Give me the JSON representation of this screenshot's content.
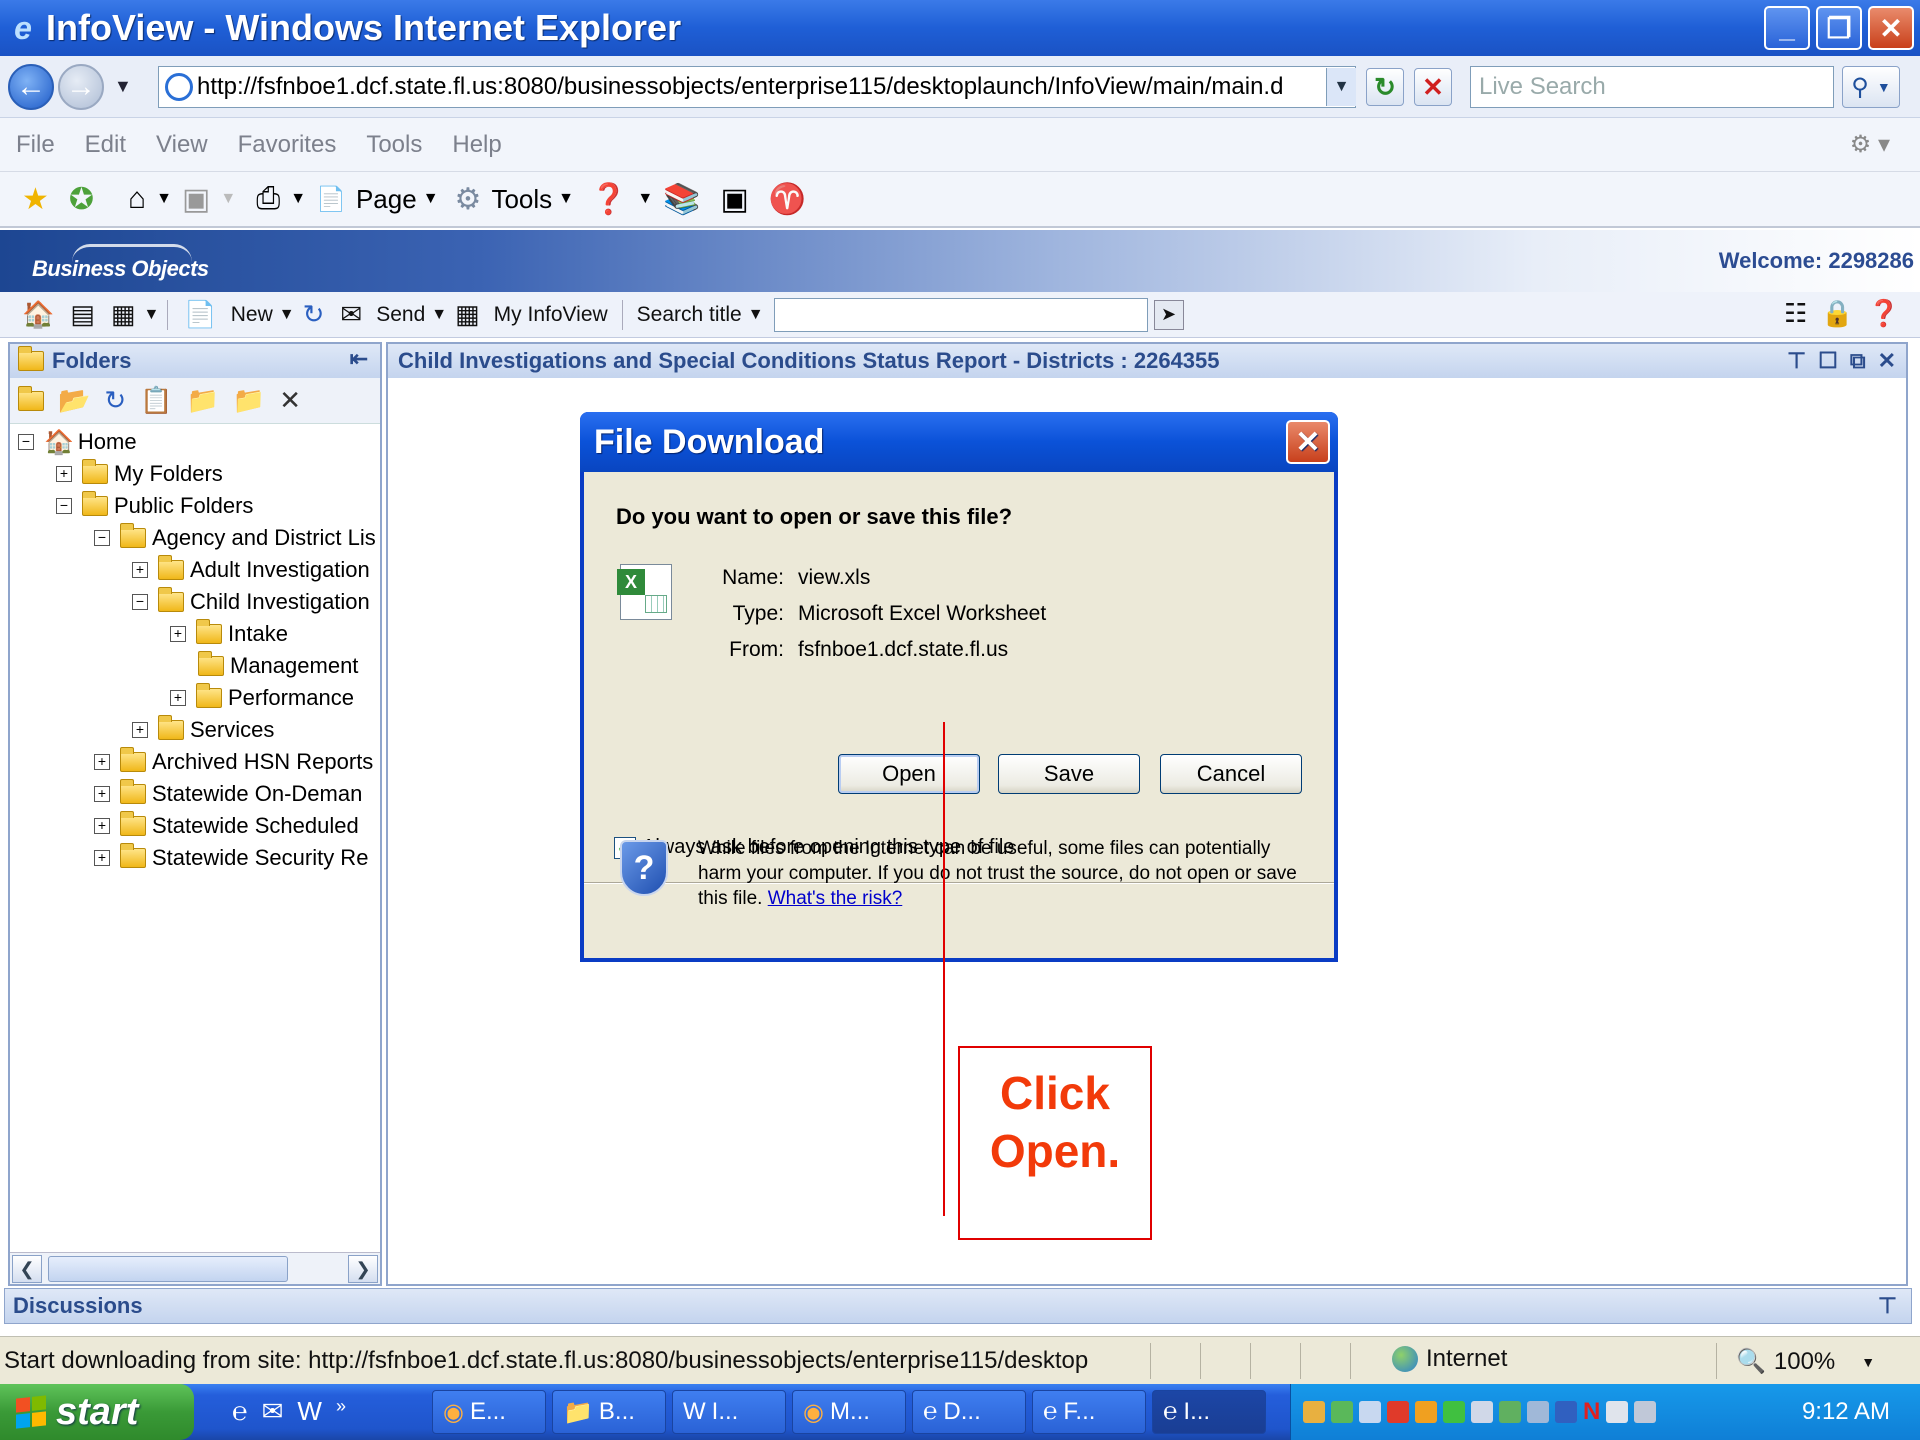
{
  "window": {
    "title": "InfoView - Windows Internet Explorer",
    "minimize": "_",
    "maximize": "❐",
    "close": "✕"
  },
  "address": {
    "url": "http://fsfnboe1.dcf.state.fl.us:8080/businessobjects/enterprise115/desktoplaunch/InfoView/main/main.d",
    "search_placeholder": "Live Search"
  },
  "menu": {
    "items": [
      "File",
      "Edit",
      "View",
      "Favorites",
      "Tools",
      "Help"
    ]
  },
  "commandbar": {
    "page_label": "Page",
    "tools_label": "Tools"
  },
  "infoview": {
    "logo": "Business Objects",
    "welcome": "Welcome: 2298286",
    "toolbar": {
      "new_label": "New",
      "send_label": "Send",
      "myinfoview_label": "My InfoView",
      "search_title_label": "Search title"
    }
  },
  "folders": {
    "title": "Folders",
    "tree": [
      {
        "label": "Home",
        "expander": "−"
      },
      {
        "label": "My Folders",
        "expander": "+"
      },
      {
        "label": "Public Folders",
        "expander": "−"
      },
      {
        "label": "Agency and District Lis",
        "expander": "−"
      },
      {
        "label": "Adult Investigation",
        "expander": "+"
      },
      {
        "label": "Child Investigation",
        "expander": "−"
      },
      {
        "label": "Intake",
        "expander": "+"
      },
      {
        "label": "Management",
        "expander": ""
      },
      {
        "label": "Performance",
        "expander": "+"
      },
      {
        "label": "Services",
        "expander": "+"
      },
      {
        "label": "Archived HSN Reports",
        "expander": "+"
      },
      {
        "label": "Statewide On-Deman",
        "expander": "+"
      },
      {
        "label": "Statewide Scheduled",
        "expander": "+"
      },
      {
        "label": "Statewide Security Re",
        "expander": "+"
      }
    ]
  },
  "report": {
    "title": "Child Investigations and Special Conditions Status Report - Districts : 2264355"
  },
  "dialog": {
    "title": "File Download",
    "question": "Do you want to open or save this file?",
    "name_key": "Name:",
    "name_value": "view.xls",
    "type_key": "Type:",
    "type_value": "Microsoft Excel Worksheet",
    "from_key": "From:",
    "from_value": "fsfnboe1.dcf.state.fl.us",
    "open_label": "Open",
    "save_label": "Save",
    "cancel_label": "Cancel",
    "checkbox_label": "Always ask before opening this type of file",
    "checkbox_checked": true,
    "warning_text": "While files from the Internet can be useful, some files can potentially harm your computer. If you do not trust the source, do not open or save this file.",
    "risk_link": "What's the risk?"
  },
  "callout": {
    "line1": "Click",
    "line2": "Open.",
    "color": "#e00000"
  },
  "discussions": {
    "title": "Discussions"
  },
  "status": {
    "message": "Start downloading from site: http://fsfnboe1.dcf.state.fl.us:8080/businessobjects/enterprise115/desktop",
    "zone": "Internet",
    "zoom": "100%"
  },
  "taskbar": {
    "start": "start",
    "tasks": [
      "E...",
      "B...",
      "I...",
      "M...",
      "D...",
      "F...",
      "I..."
    ],
    "clock": "9:12 AM"
  }
}
